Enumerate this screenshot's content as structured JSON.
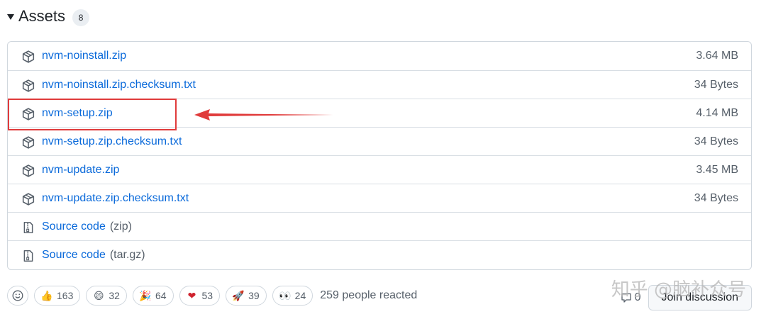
{
  "header": {
    "title": "Assets",
    "count": "8"
  },
  "assets": [
    {
      "name": "nvm-noinstall.zip",
      "size": "3.64 MB",
      "icon": "package-icon"
    },
    {
      "name": "nvm-noinstall.zip.checksum.txt",
      "size": "34 Bytes",
      "icon": "package-icon"
    },
    {
      "name": "nvm-setup.zip",
      "size": "4.14 MB",
      "icon": "package-icon"
    },
    {
      "name": "nvm-setup.zip.checksum.txt",
      "size": "34 Bytes",
      "icon": "package-icon"
    },
    {
      "name": "nvm-update.zip",
      "size": "3.45 MB",
      "icon": "package-icon"
    },
    {
      "name": "nvm-update.zip.checksum.txt",
      "size": "34 Bytes",
      "icon": "package-icon"
    },
    {
      "name": "Source code",
      "suffix": "(zip)",
      "size": "",
      "icon": "file-zip-icon"
    },
    {
      "name": "Source code",
      "suffix": "(tar.gz)",
      "size": "",
      "icon": "file-zip-icon"
    }
  ],
  "reactions": [
    {
      "emoji": "👍",
      "count": "163"
    },
    {
      "emoji": "😄",
      "count": "32"
    },
    {
      "emoji": "🎉",
      "count": "64"
    },
    {
      "emoji": "❤",
      "count": "53"
    },
    {
      "emoji": "🚀",
      "count": "39"
    },
    {
      "emoji": "👀",
      "count": "24"
    }
  ],
  "reacted_text": "259 people reacted",
  "discussion": {
    "comment_count": "0",
    "join_label": "Join discussion"
  },
  "watermark": "知乎 @脑补众号",
  "colors": {
    "link": "#0969da",
    "highlight": "#e03b3b"
  }
}
